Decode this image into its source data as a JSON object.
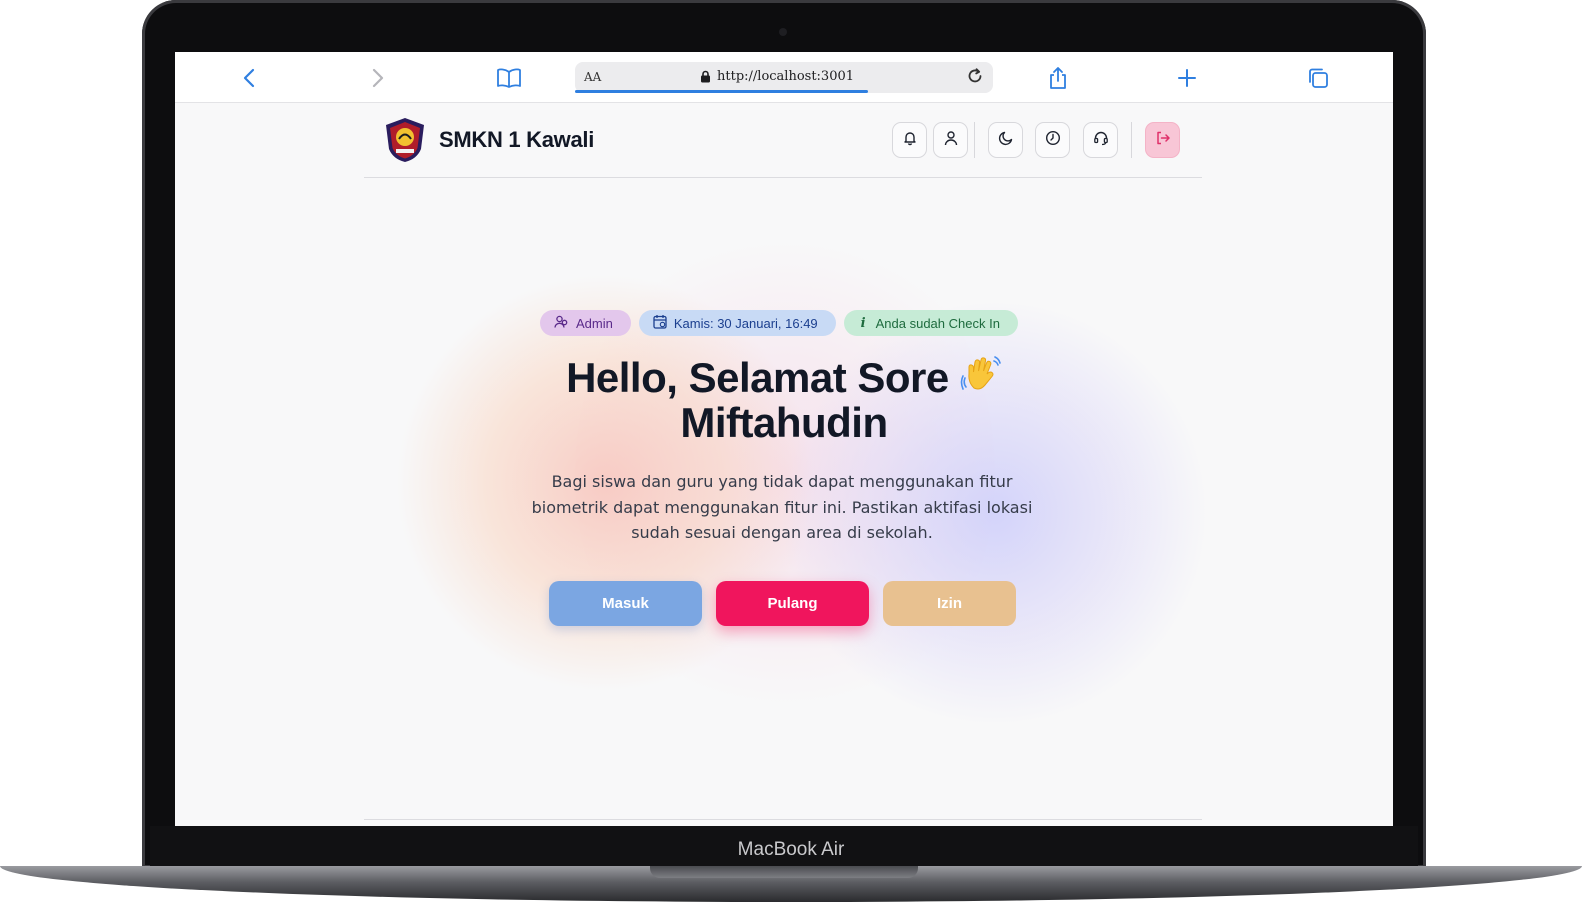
{
  "device": {
    "model_label": "MacBook Air"
  },
  "browser": {
    "reader_label": "AA",
    "url": "http://localhost:3001",
    "load_progress": 0.7,
    "accent": "#2f7fe0",
    "icons": [
      "back-icon",
      "forward-icon",
      "bookmarks-icon",
      "lock-icon",
      "reload-icon",
      "share-icon",
      "new-tab-icon",
      "tabs-icon"
    ]
  },
  "header": {
    "brand": "SMKN 1 Kawali",
    "buttons": [
      "bell-icon",
      "user-icon",
      "theme-toggle-icon",
      "clock-icon",
      "support-headset-icon",
      "logout-icon"
    ],
    "logout_color": "#e0306a"
  },
  "badges": {
    "role": "Admin",
    "date": "Kamis: 30 Januari, 16:49",
    "status_icon": "i",
    "status": "Anda sudah Check In"
  },
  "hero": {
    "line1": "Hello, Selamat Sore",
    "line2": "Miftahudin",
    "description": "Bagi siswa dan guru yang tidak dapat menggunakan fitur biometrik dapat menggunakan fitur ini. Pastikan aktifasi lokasi sudah sesuai dengan area di sekolah."
  },
  "actions": {
    "check_in": "Masuk",
    "check_out": "Pulang",
    "permission": "Izin",
    "colors": {
      "check_in": "#7ba6e2",
      "check_out": "#f0155d",
      "permission": "#e8c190"
    }
  }
}
